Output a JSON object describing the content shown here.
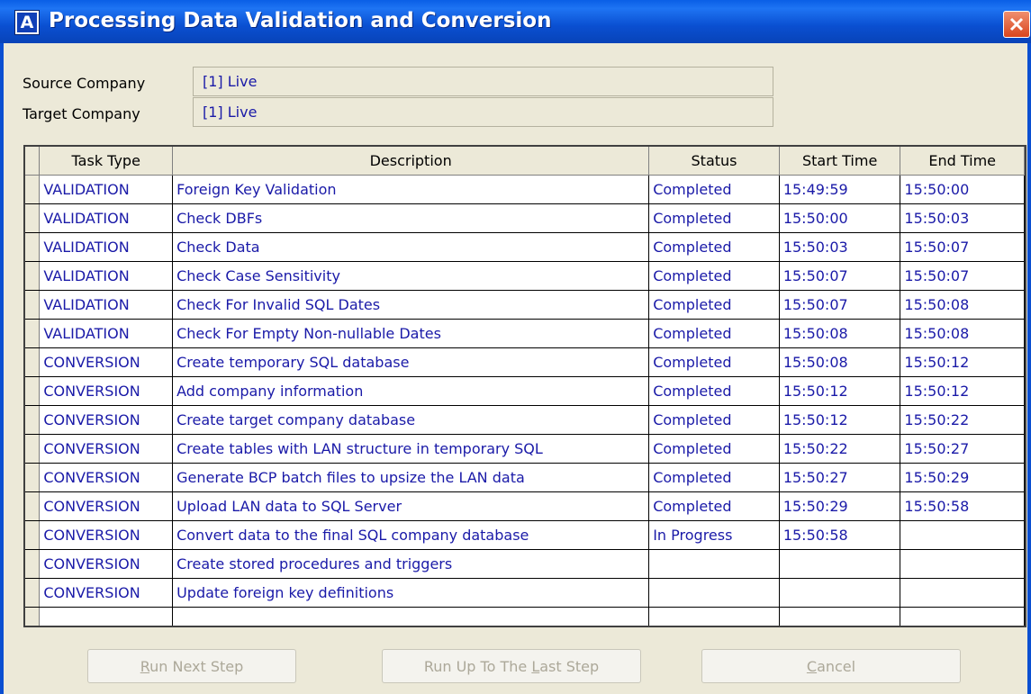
{
  "window": {
    "title": "Processing Data Validation and Conversion",
    "icon_letter": "A"
  },
  "source": {
    "label": "Source Company",
    "value": "[1] Live"
  },
  "target": {
    "label": "Target Company",
    "value": "[1] Live"
  },
  "columns": [
    "Task Type",
    "Description",
    "Status",
    "Start Time",
    "End Time"
  ],
  "rows": [
    [
      "VALIDATION",
      "Foreign Key Validation",
      "Completed",
      "15:49:59",
      "15:50:00"
    ],
    [
      "VALIDATION",
      "Check DBFs",
      "Completed",
      "15:50:00",
      "15:50:03"
    ],
    [
      "VALIDATION",
      "Check Data",
      "Completed",
      "15:50:03",
      "15:50:07"
    ],
    [
      "VALIDATION",
      "Check Case Sensitivity",
      "Completed",
      "15:50:07",
      "15:50:07"
    ],
    [
      "VALIDATION",
      "Check For Invalid SQL Dates",
      "Completed",
      "15:50:07",
      "15:50:08"
    ],
    [
      "VALIDATION",
      "Check For Empty Non-nullable Dates",
      "Completed",
      "15:50:08",
      "15:50:08"
    ],
    [
      "CONVERSION",
      "Create temporary SQL database",
      "Completed",
      "15:50:08",
      "15:50:12"
    ],
    [
      "CONVERSION",
      "Add company information",
      "Completed",
      "15:50:12",
      "15:50:12"
    ],
    [
      "CONVERSION",
      "Create target company database",
      "Completed",
      "15:50:12",
      "15:50:22"
    ],
    [
      "CONVERSION",
      "Create tables with LAN structure in temporary SQL",
      "Completed",
      "15:50:22",
      "15:50:27"
    ],
    [
      "CONVERSION",
      "Generate BCP batch files to upsize the LAN data",
      "Completed",
      "15:50:27",
      "15:50:29"
    ],
    [
      "CONVERSION",
      "Upload LAN data to SQL Server",
      "Completed",
      "15:50:29",
      "15:50:58"
    ],
    [
      "CONVERSION",
      "Convert data to the final SQL company database",
      "In Progress",
      "15:50:58",
      ""
    ],
    [
      "CONVERSION",
      "Create stored procedures and triggers",
      "",
      "",
      ""
    ],
    [
      "CONVERSION",
      "Update foreign key definitions",
      "",
      "",
      ""
    ],
    [
      "",
      "",
      "",
      "",
      ""
    ]
  ],
  "buttons": {
    "run_next": {
      "label": "Run Next Step",
      "mnemonic": "R",
      "rest": "un Next Step"
    },
    "run_last": {
      "pre": "Run Up To The ",
      "mnemonic": "L",
      "rest": "ast Step"
    },
    "cancel": {
      "mnemonic": "C",
      "rest": "ancel"
    }
  },
  "colors": {
    "title_bar": "#0a4fd1",
    "cell_text": "#1a1aa8",
    "dialog_bg": "#ece9d8"
  }
}
